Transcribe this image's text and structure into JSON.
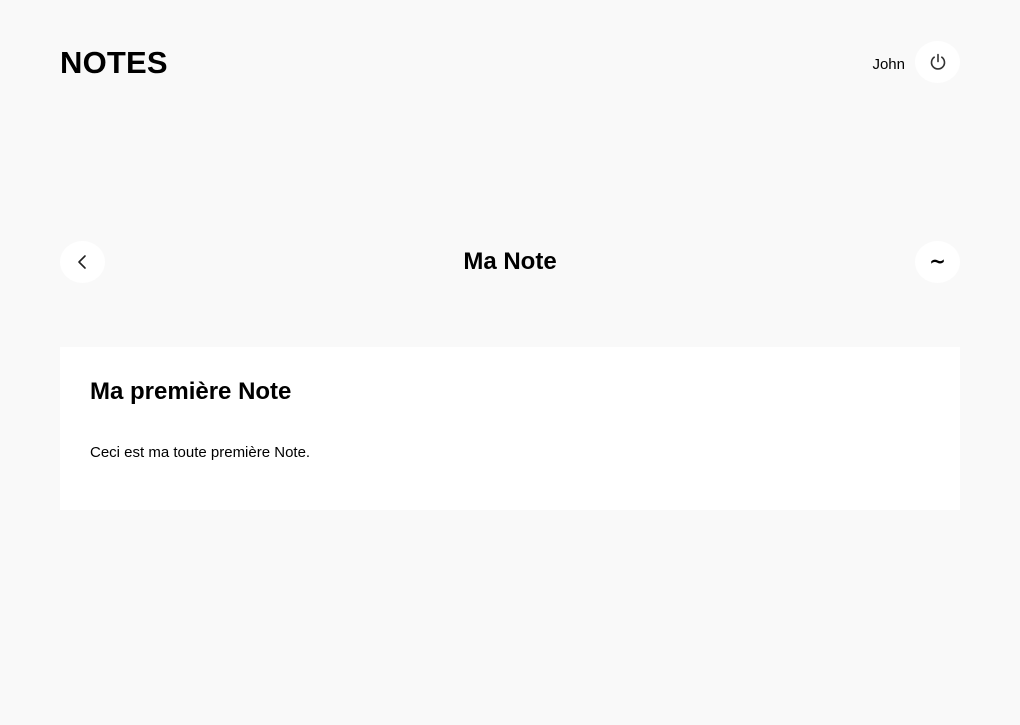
{
  "header": {
    "app_title": "NOTES",
    "user_name": "John",
    "logout_icon": "power-icon"
  },
  "page": {
    "title": "Ma Note",
    "back_icon": "chevron-left-icon",
    "edit_glyph": "~"
  },
  "note": {
    "title": "Ma première Note",
    "body": "Ceci est ma toute première Note."
  },
  "colors": {
    "background": "#f9f9f9",
    "surface": "#ffffff",
    "text": "#000000"
  }
}
